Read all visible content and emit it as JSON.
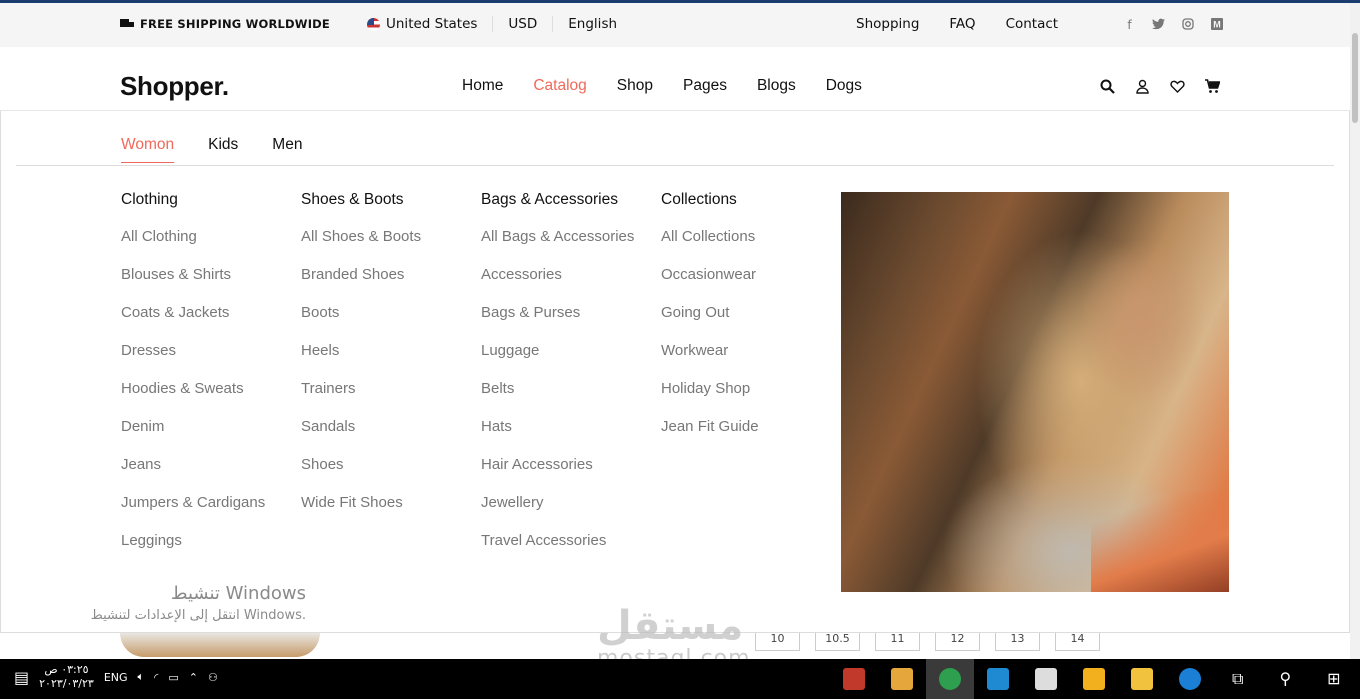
{
  "topbar": {
    "shipping": "FREE SHIPPING WORLDWIDE",
    "country": "United States",
    "currency": "USD",
    "language": "English",
    "links": [
      "Shopping",
      "FAQ",
      "Contact"
    ],
    "social": [
      "facebook-icon",
      "twitter-icon",
      "instagram-icon",
      "medium-icon"
    ]
  },
  "header": {
    "logo": "Shopper.",
    "nav": [
      "Home",
      "Catalog",
      "Shop",
      "Pages",
      "Blogs",
      "Dogs"
    ],
    "active_nav": "Catalog",
    "icons": [
      "search-icon",
      "user-icon",
      "heart-icon",
      "cart-icon"
    ]
  },
  "menu": {
    "tabs": [
      "Womon",
      "Kids",
      "Men"
    ],
    "active_tab": "Womon",
    "columns": [
      {
        "title": "Clothing",
        "items": [
          "All Clothing",
          "Blouses & Shirts",
          "Coats & Jackets",
          "Dresses",
          "Hoodies & Sweats",
          "Denim",
          "Jeans",
          "Jumpers & Cardigans",
          "Leggings"
        ]
      },
      {
        "title": "Shoes & Boots",
        "items": [
          "All Shoes & Boots",
          "Branded Shoes",
          "Boots",
          "Heels",
          "Trainers",
          "Sandals",
          "Shoes",
          "Wide Fit Shoes"
        ]
      },
      {
        "title": "Bags & Accessories",
        "items": [
          "All Bags & Accessories",
          "Accessories",
          "Bags & Purses",
          "Luggage",
          "Belts",
          "Hats",
          "Hair Accessories",
          "Jewellery",
          "Travel Accessories"
        ]
      },
      {
        "title": "Collections",
        "items": [
          "All Collections",
          "Occasionwear",
          "Going Out",
          "Workwear",
          "Holiday Shop",
          "Jean Fit Guide"
        ]
      }
    ]
  },
  "windows_activation": {
    "title": "تنشيط Windows",
    "subtitle": "انتقل إلى الإعدادات لتنشيط Windows."
  },
  "watermark": {
    "arabic": "مستقل",
    "latin": "mostaql.com"
  },
  "background_sizes": [
    "10",
    "10.5",
    "11",
    "12",
    "13",
    "14"
  ],
  "taskbar": {
    "time": "٠٣:٢٥ ص",
    "date": "٢٠٢٣/٠٣/٢٣",
    "lang": "ENG",
    "apps": [
      {
        "name": "app-p-icon",
        "color": "#c0392b"
      },
      {
        "name": "paint-icon",
        "color": "#e5a63b"
      },
      {
        "name": "chrome-icon",
        "color": "#2e9e4f"
      },
      {
        "name": "vscode-icon",
        "color": "#1f8ad2"
      },
      {
        "name": "mail-icon",
        "color": "#dddddd"
      },
      {
        "name": "store-icon",
        "color": "#f2b01e"
      },
      {
        "name": "file-explorer-icon",
        "color": "#f0c23e"
      },
      {
        "name": "edge-icon",
        "color": "#1b7fd6"
      }
    ]
  }
}
